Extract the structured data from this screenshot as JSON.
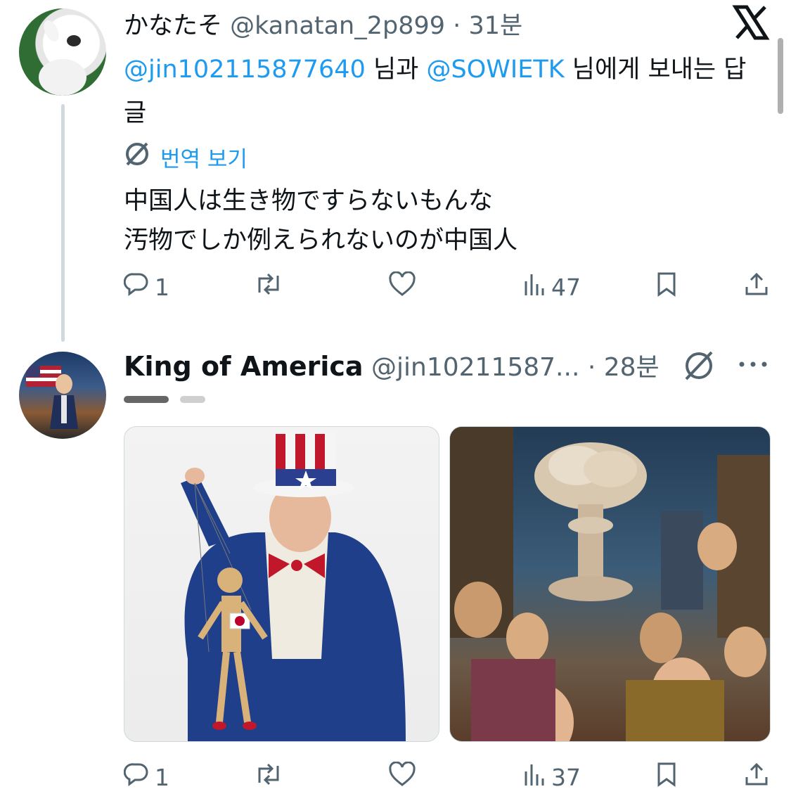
{
  "tweet1": {
    "display_name": "かなたそ",
    "handle": "@kanatan_2p899",
    "separator": "·",
    "time": "31분",
    "reply_to_user1": "@jin102115877640",
    "reply_to_join": " 님과 ",
    "reply_to_user2": "@SOWIETK",
    "reply_to_suffix": " 님에게 보내는 답글",
    "translate_label": "번역 보기",
    "text": "中国人は生き物ですらないもんな\n汚物でしか例えられないのが中国人",
    "replies": "1",
    "views": "47"
  },
  "tweet2": {
    "display_name": "King of America",
    "handle": "@jin10211587...",
    "separator": "·",
    "time": "28분",
    "replies": "1",
    "views": "37"
  },
  "colors": {
    "accent": "#1d9bf0",
    "muted": "#536471",
    "text": "#0f1419",
    "line": "#cfd9de"
  },
  "icons": [
    "x-logo-icon",
    "translate-icon",
    "reply-icon",
    "retweet-icon",
    "like-icon",
    "views-icon",
    "bookmark-icon",
    "share-icon",
    "more-icon"
  ]
}
